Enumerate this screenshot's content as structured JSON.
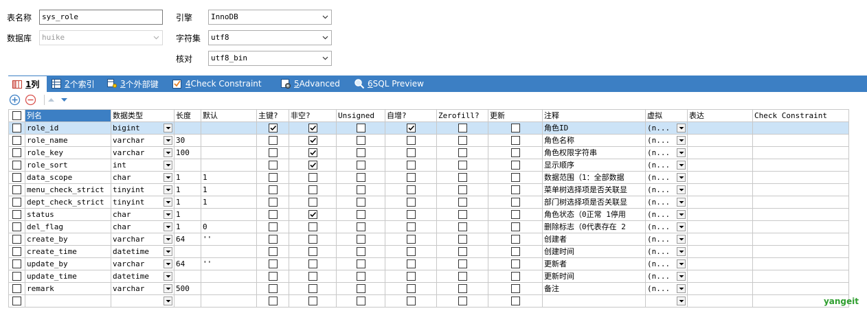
{
  "form": {
    "table_name_label": "表名称",
    "table_name_value": "sys_role",
    "database_label": "数据库",
    "database_value": "huike",
    "engine_label": "引擎",
    "engine_value": "InnoDB",
    "charset_label": "字符集",
    "charset_value": "utf8",
    "collation_label": "核对",
    "collation_value": "utf8_bin"
  },
  "tabs": [
    {
      "num": "1",
      "label": " 列"
    },
    {
      "num": "2",
      "label": " 个索引"
    },
    {
      "num": "3",
      "label": " 个外部键"
    },
    {
      "num": "4",
      "label": " Check Constraint"
    },
    {
      "num": "5",
      "label": " Advanced"
    },
    {
      "num": "6",
      "label": " SQL Preview"
    }
  ],
  "columns": {
    "name": "列名",
    "type": "数据类型",
    "length": "长度",
    "default": "默认",
    "pk": "主键?",
    "notnull": "非空?",
    "unsigned": "Unsigned",
    "autoinc": "自增?",
    "zerofill": "Zerofill?",
    "update": "更新",
    "comment": "注释",
    "virtual": "虚拟",
    "expression": "表达",
    "check": "Check Constraint"
  },
  "rows": [
    {
      "name": "role_id",
      "type": "bigint",
      "length": "",
      "default": "",
      "pk": true,
      "notnull": true,
      "unsigned": false,
      "autoinc": true,
      "zerofill": false,
      "update": false,
      "comment": "角色ID",
      "virtual": "(n..."
    },
    {
      "name": "role_name",
      "type": "varchar",
      "length": "30",
      "default": "",
      "pk": false,
      "notnull": true,
      "unsigned": false,
      "autoinc": false,
      "zerofill": false,
      "update": false,
      "comment": "角色名称",
      "virtual": "(n..."
    },
    {
      "name": "role_key",
      "type": "varchar",
      "length": "100",
      "default": "",
      "pk": false,
      "notnull": true,
      "unsigned": false,
      "autoinc": false,
      "zerofill": false,
      "update": false,
      "comment": "角色权限字符串",
      "virtual": "(n..."
    },
    {
      "name": "role_sort",
      "type": "int",
      "length": "",
      "default": "",
      "pk": false,
      "notnull": true,
      "unsigned": false,
      "autoinc": false,
      "zerofill": false,
      "update": false,
      "comment": "显示顺序",
      "virtual": "(n..."
    },
    {
      "name": "data_scope",
      "type": "char",
      "length": "1",
      "default": "1",
      "pk": false,
      "notnull": false,
      "unsigned": false,
      "autoinc": false,
      "zerofill": false,
      "update": false,
      "comment": "数据范围（1：全部数据",
      "virtual": "(n..."
    },
    {
      "name": "menu_check_strict",
      "type": "tinyint",
      "length": "1",
      "default": "1",
      "pk": false,
      "notnull": false,
      "unsigned": false,
      "autoinc": false,
      "zerofill": false,
      "update": false,
      "comment": "菜单树选择项是否关联显",
      "virtual": "(n..."
    },
    {
      "name": "dept_check_strict",
      "type": "tinyint",
      "length": "1",
      "default": "1",
      "pk": false,
      "notnull": false,
      "unsigned": false,
      "autoinc": false,
      "zerofill": false,
      "update": false,
      "comment": "部门树选择项是否关联显",
      "virtual": "(n..."
    },
    {
      "name": "status",
      "type": "char",
      "length": "1",
      "default": "",
      "pk": false,
      "notnull": true,
      "unsigned": false,
      "autoinc": false,
      "zerofill": false,
      "update": false,
      "comment": "角色状态（0正常 1停用",
      "virtual": "(n..."
    },
    {
      "name": "del_flag",
      "type": "char",
      "length": "1",
      "default": "0",
      "pk": false,
      "notnull": false,
      "unsigned": false,
      "autoinc": false,
      "zerofill": false,
      "update": false,
      "comment": "删除标志（0代表存在 2",
      "virtual": "(n..."
    },
    {
      "name": "create_by",
      "type": "varchar",
      "length": "64",
      "default": "''",
      "pk": false,
      "notnull": false,
      "unsigned": false,
      "autoinc": false,
      "zerofill": false,
      "update": false,
      "comment": "创建者",
      "virtual": "(n..."
    },
    {
      "name": "create_time",
      "type": "datetime",
      "length": "",
      "default": "",
      "pk": false,
      "notnull": false,
      "unsigned": false,
      "autoinc": false,
      "zerofill": false,
      "update": false,
      "comment": "创建时间",
      "virtual": "(n..."
    },
    {
      "name": "update_by",
      "type": "varchar",
      "length": "64",
      "default": "''",
      "pk": false,
      "notnull": false,
      "unsigned": false,
      "autoinc": false,
      "zerofill": false,
      "update": false,
      "comment": "更新者",
      "virtual": "(n..."
    },
    {
      "name": "update_time",
      "type": "datetime",
      "length": "",
      "default": "",
      "pk": false,
      "notnull": false,
      "unsigned": false,
      "autoinc": false,
      "zerofill": false,
      "update": false,
      "comment": "更新时间",
      "virtual": "(n..."
    },
    {
      "name": "remark",
      "type": "varchar",
      "length": "500",
      "default": "",
      "pk": false,
      "notnull": false,
      "unsigned": false,
      "autoinc": false,
      "zerofill": false,
      "update": false,
      "comment": "备注",
      "virtual": "(n..."
    },
    {
      "name": "",
      "type": "",
      "length": "",
      "default": "",
      "pk": false,
      "notnull": false,
      "unsigned": false,
      "autoinc": false,
      "zerofill": false,
      "update": false,
      "comment": "",
      "virtual": ""
    }
  ],
  "selected_row": 0,
  "watermark": "yangeit",
  "colors": {
    "accent": "#3c7fc4",
    "selection": "#cce3f7",
    "watermark": "#2e9e2e"
  }
}
